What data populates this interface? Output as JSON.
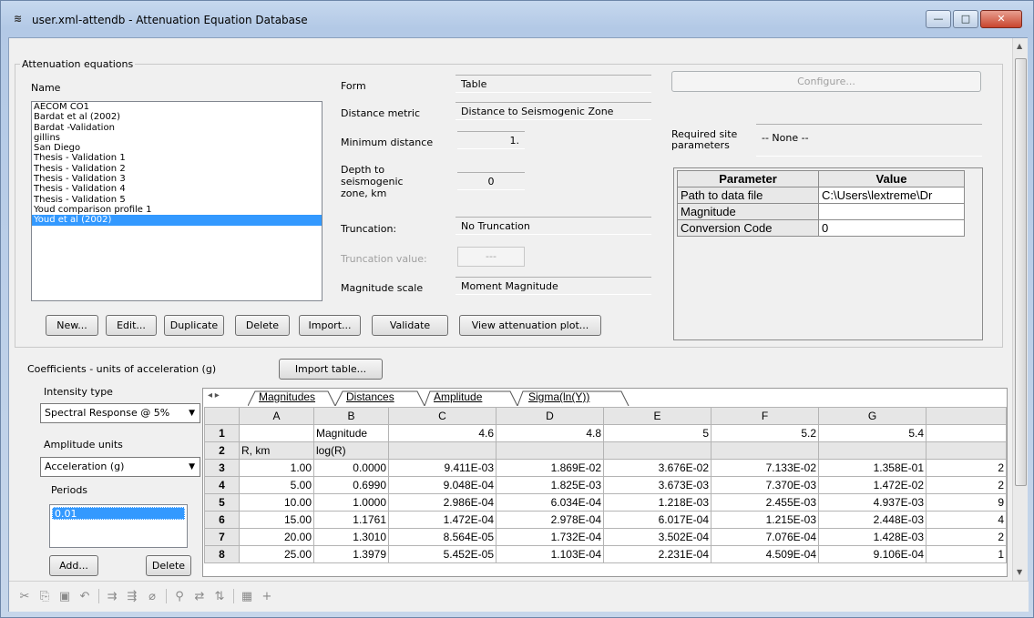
{
  "window": {
    "title": "user.xml-attendb - Attenuation Equation Database",
    "minimize": "—",
    "maximize": "□",
    "close": "✕"
  },
  "equations": {
    "group_label": "Attenuation equations",
    "name_label": "Name",
    "items": [
      "AECOM CO1",
      "Bardat et al (2002)",
      "Bardat -Validation",
      "gillins",
      "San Diego",
      "Thesis - Validation 1",
      "Thesis - Validation 2",
      "Thesis - Validation 3",
      "Thesis - Validation 4",
      "Thesis - Validation 5",
      "Youd comparison profile 1",
      "Youd et al (2002)"
    ],
    "selected": "Youd et al (2002)"
  },
  "props": {
    "form_label": "Form",
    "form_value": "Table",
    "distance_metric_label": "Distance metric",
    "distance_metric_value": "Distance to Seismogenic Zone",
    "min_distance_label": "Minimum distance",
    "min_distance_value": "1.",
    "depth_label": "Depth to seismogenic zone, km",
    "depth_value": "0",
    "truncation_label": "Truncation:",
    "truncation_value": "No Truncation",
    "truncation_value_label": "Truncation value:",
    "truncation_value_value": "---",
    "magnitude_scale_label": "Magnitude scale",
    "magnitude_scale_value": "Moment Magnitude"
  },
  "config": {
    "configure_label": "Configure...",
    "required_label": "Required site parameters",
    "required_value": "-- None --"
  },
  "param_table": {
    "headers": [
      "Parameter",
      "Value"
    ],
    "rows": [
      {
        "param": "Path to data file",
        "value": "C:\\Users\\lextreme\\Dr"
      },
      {
        "param": "Magnitude",
        "value": ""
      },
      {
        "param": "Conversion Code",
        "value": "0"
      }
    ]
  },
  "buttons": {
    "new": "New...",
    "edit": "Edit...",
    "duplicate": "Duplicate",
    "delete": "Delete",
    "import": "Import...",
    "validate": "Validate",
    "view_plot": "View attenuation plot...",
    "import_table": "Import table...",
    "add_period": "Add...",
    "delete_period": "Delete"
  },
  "coefficients": {
    "label": "Coefficients - units of acceleration (g)",
    "intensity_label": "Intensity type",
    "intensity_value": "Spectral Response @ 5%",
    "amplitude_label": "Amplitude units",
    "amplitude_value": "Acceleration (g)",
    "periods_label": "Periods",
    "periods": [
      "0.01"
    ]
  },
  "sheet": {
    "nav": "◂ ▸",
    "tabs": [
      "Magnitudes",
      "Distances",
      "Amplitude",
      "Sigma(ln(Y))"
    ],
    "columns": [
      "A",
      "B",
      "C",
      "D",
      "E",
      "F",
      "G",
      ""
    ],
    "rows": [
      [
        "1",
        "",
        "Magnitude",
        "4.6",
        "4.8",
        "5",
        "5.2",
        "5.4",
        ""
      ],
      [
        "2",
        "R, km",
        "log(R)",
        "",
        "",
        "",
        "",
        "",
        ""
      ],
      [
        "3",
        "1.00",
        "0.0000",
        "9.411E-03",
        "1.869E-02",
        "3.676E-02",
        "7.133E-02",
        "1.358E-01",
        "2"
      ],
      [
        "4",
        "5.00",
        "0.6990",
        "9.048E-04",
        "1.825E-03",
        "3.673E-03",
        "7.370E-03",
        "1.472E-02",
        "2"
      ],
      [
        "5",
        "10.00",
        "1.0000",
        "2.986E-04",
        "6.034E-04",
        "1.218E-03",
        "2.455E-03",
        "4.937E-03",
        "9"
      ],
      [
        "6",
        "15.00",
        "1.1761",
        "1.472E-04",
        "2.978E-04",
        "6.017E-04",
        "1.215E-03",
        "2.448E-03",
        "4"
      ],
      [
        "7",
        "20.00",
        "1.3010",
        "8.564E-05",
        "1.732E-04",
        "3.502E-04",
        "7.076E-04",
        "1.428E-03",
        "2"
      ],
      [
        "8",
        "25.00",
        "1.3979",
        "5.452E-05",
        "1.103E-04",
        "2.231E-04",
        "4.509E-04",
        "9.106E-04",
        "1"
      ]
    ]
  },
  "toolbar": {
    "icons": [
      "cut-icon",
      "copy-icon",
      "paste-icon",
      "undo-icon",
      "insert-row-icon",
      "insert-col-icon",
      "clear-icon",
      "find-icon",
      "replace-icon",
      "sort-icon",
      "grid-icon",
      "add-icon"
    ]
  }
}
